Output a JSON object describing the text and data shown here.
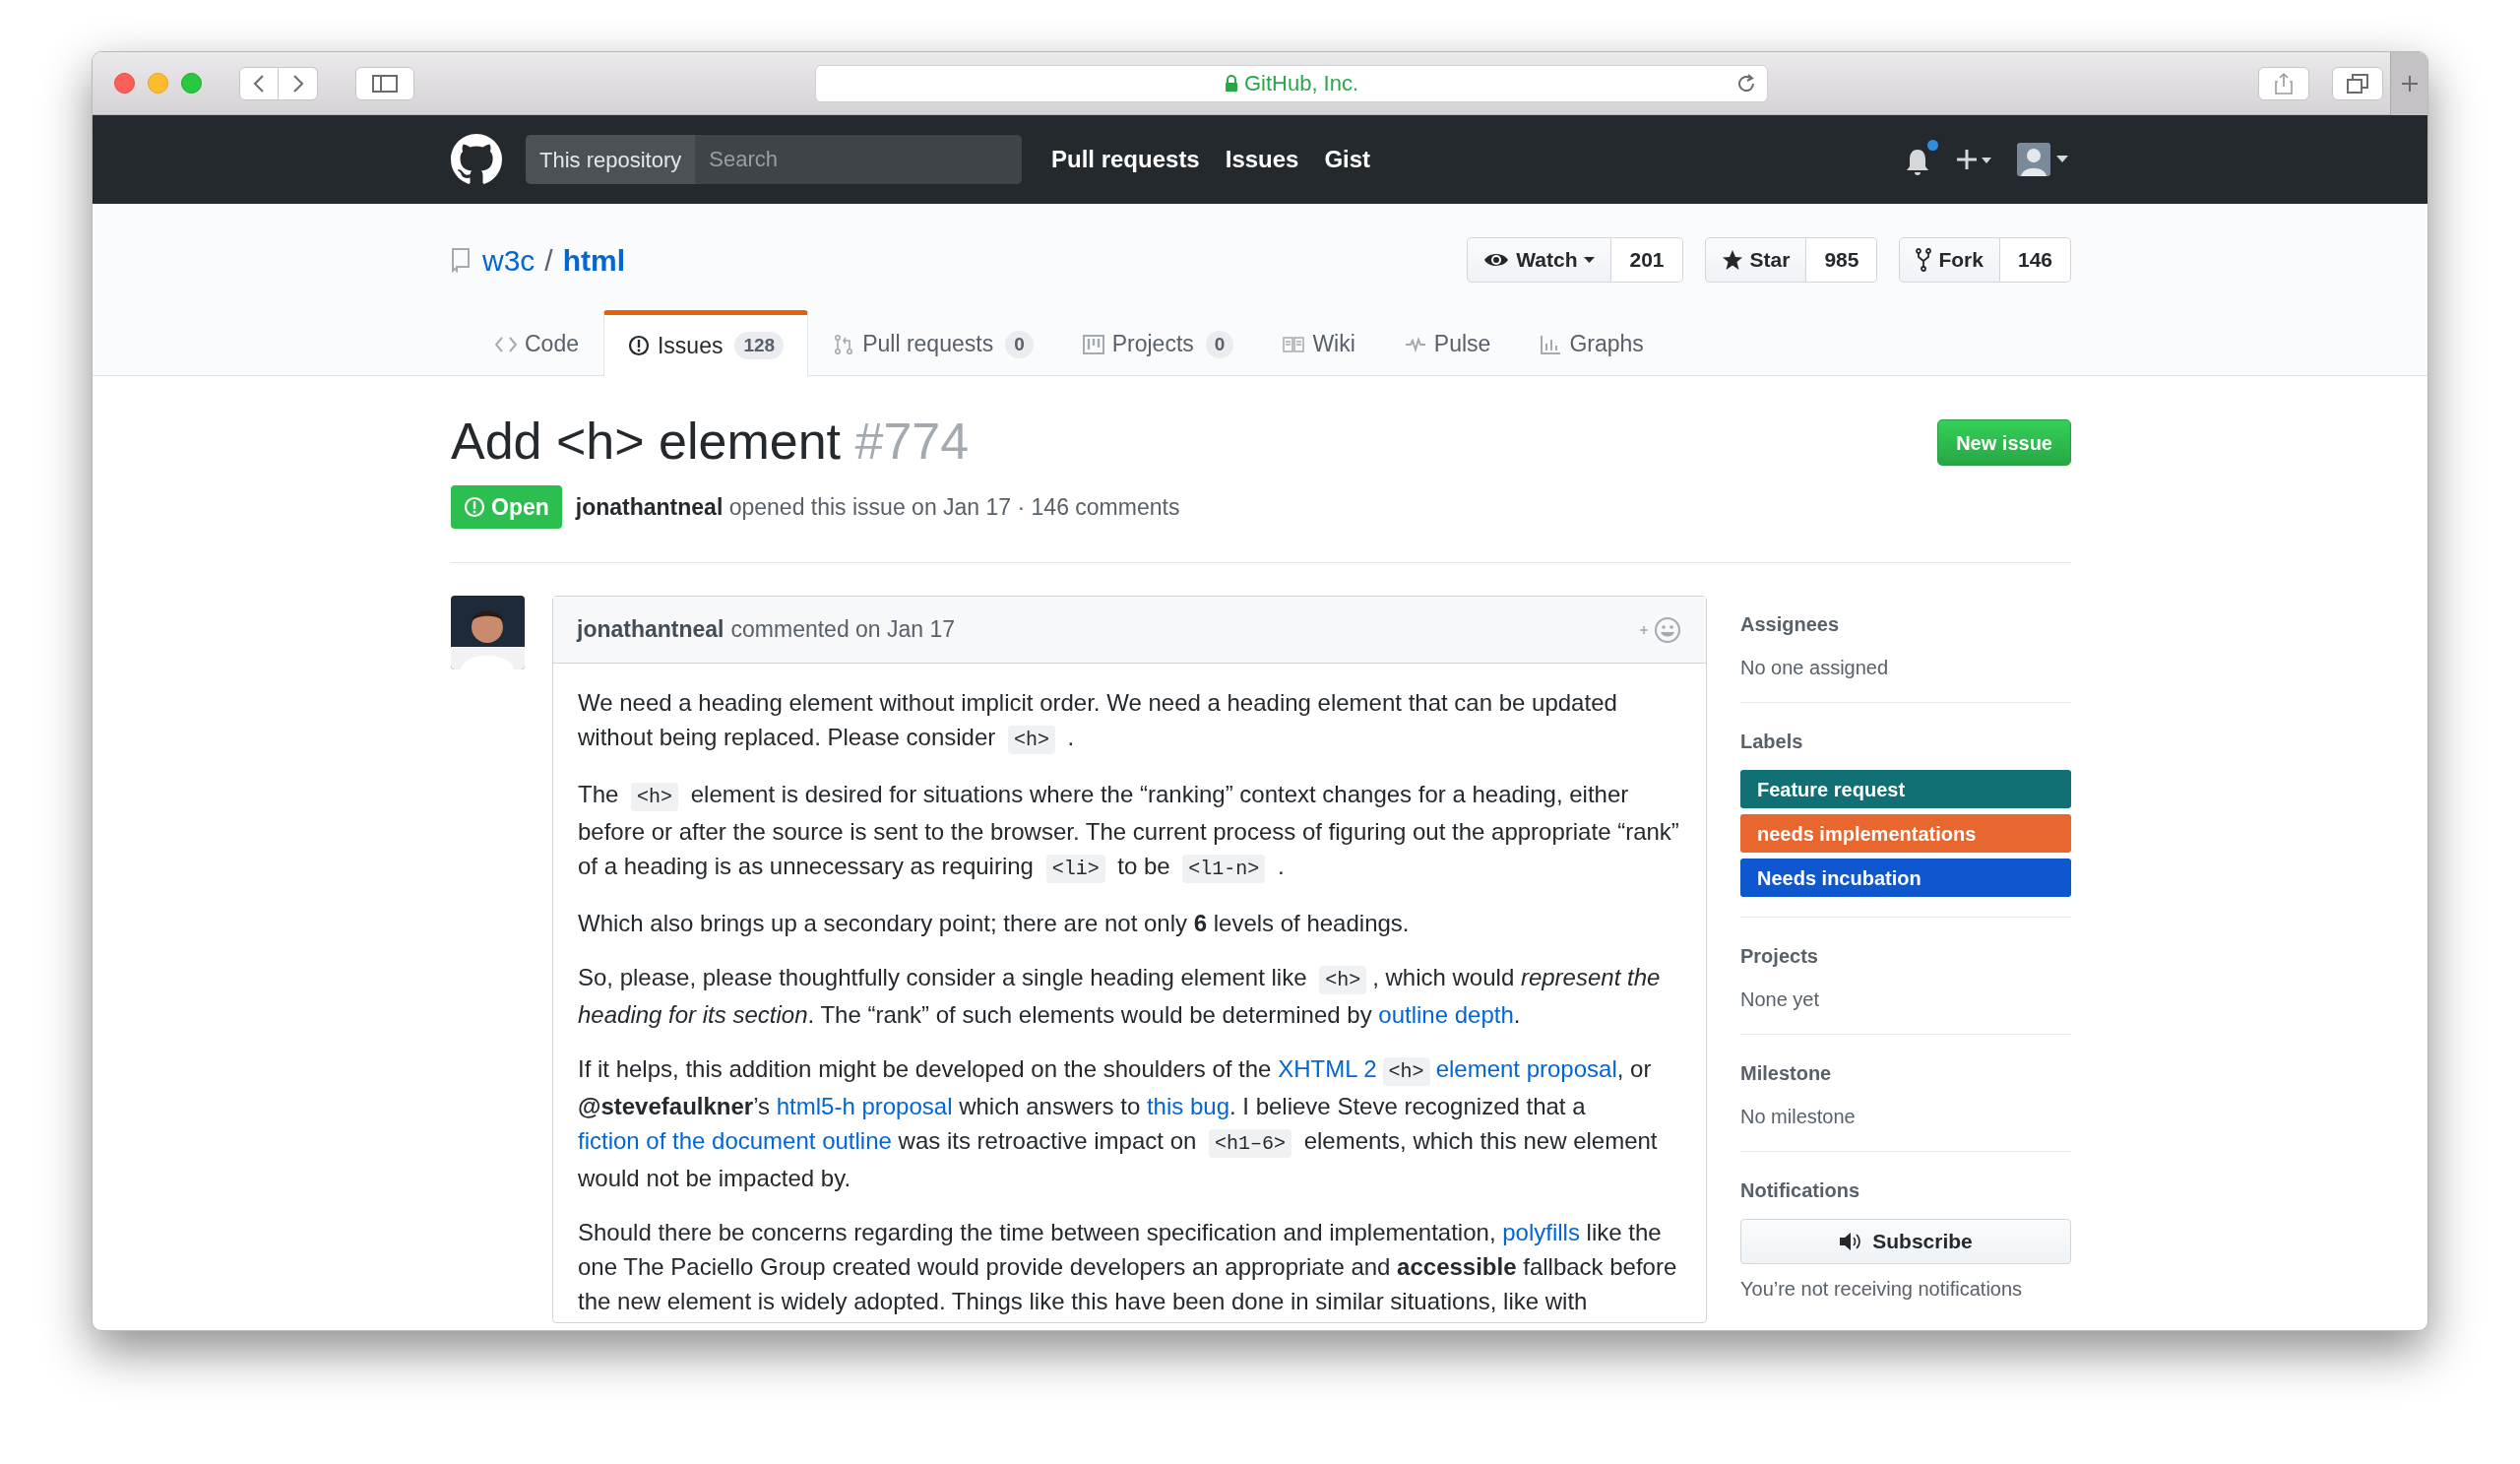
{
  "browser": {
    "address": "GitHub, Inc."
  },
  "header": {
    "scope": "This repository",
    "search": {
      "placeholder": "Search"
    },
    "nav": [
      "Pull requests",
      "Issues",
      "Gist"
    ],
    "notification_unread": true
  },
  "repo": {
    "owner": "w3c",
    "separator": "/",
    "name": "html",
    "actions": [
      {
        "kind": "watch",
        "label": "Watch",
        "count": "201"
      },
      {
        "kind": "star",
        "label": "Star",
        "count": "985"
      },
      {
        "kind": "fork",
        "label": "Fork",
        "count": "146"
      }
    ]
  },
  "tabs": [
    {
      "kind": "code",
      "label": "Code",
      "selected": false
    },
    {
      "kind": "issues",
      "label": "Issues",
      "count": "128",
      "selected": true
    },
    {
      "kind": "pulls",
      "label": "Pull requests",
      "count": "0",
      "selected": false
    },
    {
      "kind": "projects",
      "label": "Projects",
      "count": "0",
      "selected": false
    },
    {
      "kind": "wiki",
      "label": "Wiki",
      "selected": false
    },
    {
      "kind": "pulse",
      "label": "Pulse",
      "selected": false
    },
    {
      "kind": "graphs",
      "label": "Graphs",
      "selected": false
    }
  ],
  "issue": {
    "title": "Add <h> element",
    "number": "#774",
    "new_issue": "New issue",
    "state": {
      "kind": "open",
      "label": "Open"
    },
    "author": "jonathantneal",
    "meta": "opened this issue on Jan 17 · 146 comments"
  },
  "comment": {
    "author": "jonathantneal",
    "meta": "commented on Jan 17",
    "paragraphs": [
      [
        {
          "kind": "text",
          "text": "We need a heading element without implicit order. We need a heading element that can be updated without being replaced. Please consider "
        },
        {
          "kind": "code",
          "text": "<h>"
        },
        {
          "kind": "text",
          "text": " ."
        }
      ],
      [
        {
          "kind": "text",
          "text": "The "
        },
        {
          "kind": "code",
          "text": "<h>"
        },
        {
          "kind": "text",
          "text": " element is desired for situations where the “ranking” context changes for a heading, either before or after the source is sent to the browser. The current process of figuring out the appropriate “rank” of a heading is as unnecessary as requiring "
        },
        {
          "kind": "code",
          "text": "<li>"
        },
        {
          "kind": "text",
          "text": " to be "
        },
        {
          "kind": "code",
          "text": "<l1-n>"
        },
        {
          "kind": "text",
          "text": " ."
        }
      ],
      [
        {
          "kind": "text",
          "text": "Which also brings up a secondary point; there are not only **6** levels of headings."
        }
      ],
      [
        {
          "kind": "text",
          "text": "So, please, please thoughtfully consider a single heading element like "
        },
        {
          "kind": "code",
          "text": "<h>"
        },
        {
          "kind": "text",
          "text": ", which would *represent the heading for its section*. The “rank” of such elements would be determined by "
        },
        {
          "kind": "link",
          "text": "outline depth"
        },
        {
          "kind": "text",
          "text": "."
        }
      ],
      [
        {
          "kind": "text",
          "text": "If it helps, this addition might be developed on the shoulders of the "
        },
        {
          "kind": "link",
          "text": "XHTML 2"
        },
        {
          "kind": "code",
          "text": "<h>"
        },
        {
          "kind": "link",
          "text": "element proposal"
        },
        {
          "kind": "text",
          "text": ", or **@stevefaulkner**’s "
        },
        {
          "kind": "link",
          "text": "html5-h proposal"
        },
        {
          "kind": "text",
          "text": " which answers to "
        },
        {
          "kind": "link",
          "text": "this bug"
        },
        {
          "kind": "text",
          "text": ". I believe Steve recognized that a "
        },
        {
          "kind": "link",
          "text": "fiction of the document outline"
        },
        {
          "kind": "text",
          "text": " was its retroactive impact on "
        },
        {
          "kind": "code",
          "text": "<h1–6>"
        },
        {
          "kind": "text",
          "text": " elements, which this new element would not be impacted by."
        }
      ],
      [
        {
          "kind": "text",
          "text": "Should there be concerns regarding the time between specification and implementation, "
        },
        {
          "kind": "link",
          "text": "polyfills"
        },
        {
          "kind": "text",
          "text": " like the one The Paciello Group created would provide developers an appropriate and **accessible** fallback before the new element is widely adopted. Things like this have been done in similar situations, like with"
        }
      ]
    ]
  },
  "sidebar": {
    "sections": [
      {
        "kind": "text",
        "heading": "Assignees",
        "value": "No one assigned"
      },
      {
        "kind": "labels",
        "heading": "Labels",
        "labels": [
          {
            "name": "Feature request",
            "color": "#107073"
          },
          {
            "name": "needs implementations",
            "color": "#e8672f"
          },
          {
            "name": "Needs incubation",
            "color": "#0e57cf"
          }
        ]
      },
      {
        "kind": "text",
        "heading": "Projects",
        "value": "None yet"
      },
      {
        "kind": "text",
        "heading": "Milestone",
        "value": "No milestone"
      },
      {
        "kind": "notifications",
        "heading": "Notifications",
        "button": "Subscribe",
        "value": "You’re not receiving notifications"
      }
    ]
  }
}
